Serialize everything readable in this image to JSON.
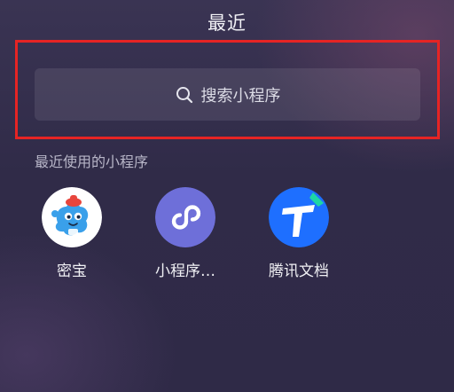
{
  "header": {
    "title": "最近"
  },
  "search": {
    "icon": "search-icon",
    "label": "搜索小程序"
  },
  "recent": {
    "section_title": "最近使用的小程序",
    "apps": [
      {
        "name": "密宝",
        "icon": "mibao-mascot-icon"
      },
      {
        "name": "小程序…",
        "icon": "mini-program-logo-icon"
      },
      {
        "name": "腾讯文档",
        "icon": "tencent-docs-icon"
      }
    ]
  },
  "colors": {
    "highlight": "#e62424",
    "mini_program_purple": "#6e6fd9",
    "docs_blue": "#1e6fff"
  }
}
